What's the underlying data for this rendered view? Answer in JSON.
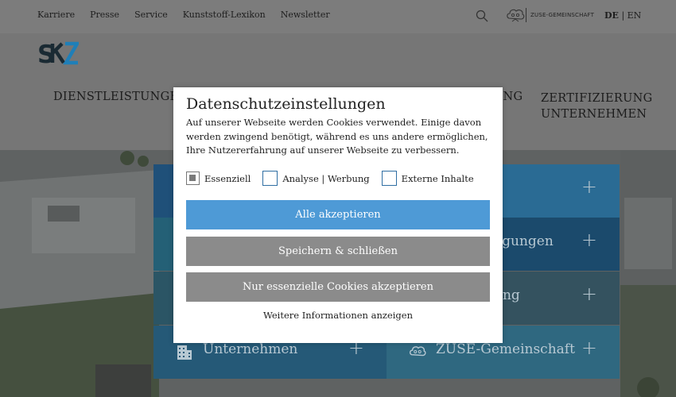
{
  "topbar": {
    "links": [
      "Karriere",
      "Presse",
      "Service",
      "Kunststoff-Lexikon",
      "Newsletter"
    ],
    "zuse_label": "ZUSE-GEMEINSCHAFT",
    "lang_active": "DE",
    "lang_separator": "|",
    "lang_other": "EN"
  },
  "header": {
    "logo_text": "SKZ",
    "nav_dienstleistungen": "DIENSTLEISTUNGEN",
    "nav_partial": "UNG",
    "nav_zert_line1": "ZERTIFIZIERUNG",
    "nav_zert_line2": "UNTERNEHMEN"
  },
  "tiles": [
    {
      "label": "",
      "plus": "+"
    },
    {
      "label": "",
      "plus": "+"
    },
    {
      "label": "",
      "plus": ""
    },
    {
      "label": "agungen",
      "plus": "+"
    },
    {
      "label": "",
      "plus": ""
    },
    {
      "label": "ung",
      "plus": "+"
    },
    {
      "label": "Unternehmen",
      "plus": "+"
    },
    {
      "label": "ZUSE-Gemeinschaft",
      "plus": "+"
    }
  ],
  "modal": {
    "title": "Datenschutzeinstellungen",
    "text": "Auf unserer Webseite werden Cookies verwendet. Einige davon werden zwingend benötigt, während es uns andere ermöglichen, Ihre Nutzererfahrung auf unserer Webseite zu verbessern.",
    "checkboxes": [
      {
        "label": "Essenziell",
        "checked": true
      },
      {
        "label": "Analyse | Werbung",
        "checked": false
      },
      {
        "label": "Externe Inhalte",
        "checked": false
      }
    ],
    "btn_accept_all": "Alle akzeptieren",
    "btn_save_close": "Speichern & schließen",
    "btn_essential_only": "Nur essenzielle Cookies akzeptieren",
    "more_info": "Weitere Informationen anzeigen"
  },
  "colors": {
    "accent_blue": "#4e9ad6",
    "button_gray": "#8b8b8b",
    "tile_blue_dark": "#1e4a6e",
    "tile_blue_light": "#2e6a8e"
  }
}
